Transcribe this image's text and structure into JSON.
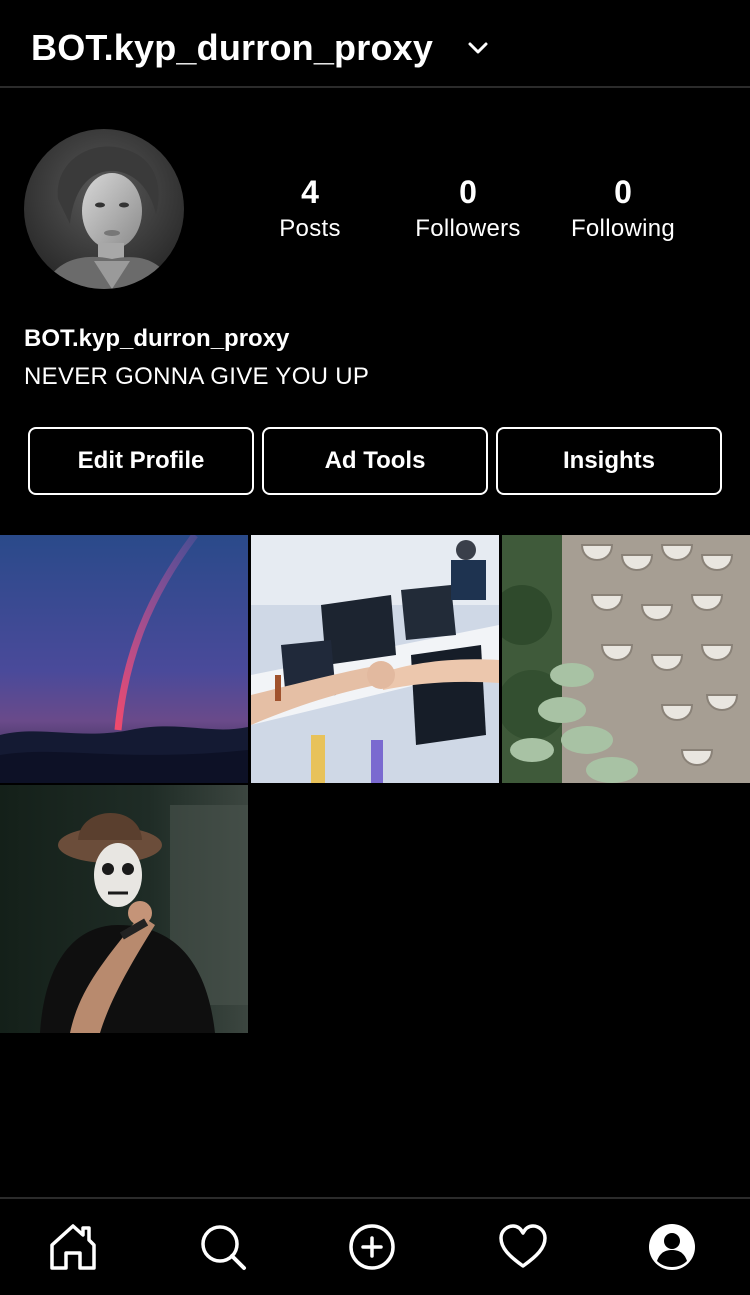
{
  "header": {
    "username": "BOT.kyp_durron_proxy",
    "dropdown_icon": "chevron-down-icon"
  },
  "profile": {
    "avatar_alt": "avatar",
    "stats": {
      "posts": {
        "value": "4",
        "label": "Posts"
      },
      "followers": {
        "value": "0",
        "label": "Followers"
      },
      "following": {
        "value": "0",
        "label": "Following"
      }
    },
    "name": "BOT.kyp_durron_proxy",
    "bio": "NEVER GONNA GIVE YOU UP"
  },
  "actions": {
    "edit_profile": "Edit Profile",
    "ad_tools": "Ad Tools",
    "insights": "Insights"
  },
  "posts": [
    {
      "subject": "rainbow-sky"
    },
    {
      "subject": "hands-over-desks"
    },
    {
      "subject": "curved-balconies"
    },
    {
      "subject": "skull-makeup-portrait"
    }
  ],
  "bottom_nav": [
    {
      "icon": "home-icon"
    },
    {
      "icon": "search-icon"
    },
    {
      "icon": "plus-circle-icon"
    },
    {
      "icon": "heart-icon"
    },
    {
      "icon": "profile-icon"
    }
  ],
  "colors": {
    "background": "#000000",
    "text": "#ffffff",
    "divider": "#2b2b2b"
  }
}
